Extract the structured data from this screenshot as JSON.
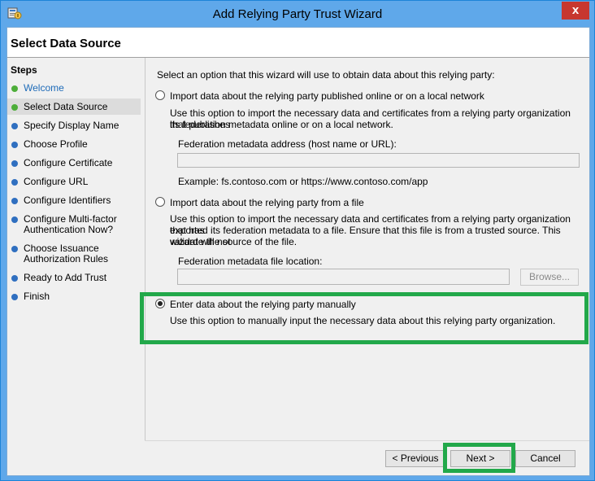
{
  "window": {
    "title": "Add Relying Party Trust Wizard",
    "close_glyph": "x",
    "app_icon": "relying-party-wizard-icon"
  },
  "header": {
    "title": "Select Data Source"
  },
  "steps": {
    "title": "Steps",
    "items": [
      {
        "label": "Welcome",
        "status": "completed"
      },
      {
        "label": "Select Data Source",
        "status": "current"
      },
      {
        "label": "Specify Display Name",
        "status": "pending"
      },
      {
        "label": "Choose Profile",
        "status": "pending"
      },
      {
        "label": "Configure Certificate",
        "status": "pending"
      },
      {
        "label": "Configure URL",
        "status": "pending"
      },
      {
        "label": "Configure Identifiers",
        "status": "pending"
      },
      {
        "label_line1": "Configure Multi-factor",
        "label_line2": "Authentication Now?",
        "status": "pending"
      },
      {
        "label_line1": "Choose Issuance",
        "label_line2": "Authorization Rules",
        "status": "pending"
      },
      {
        "label": "Ready to Add Trust",
        "status": "pending"
      },
      {
        "label": "Finish",
        "status": "pending"
      }
    ]
  },
  "content": {
    "intro": "Select an option that this wizard will use to obtain data about this relying party:",
    "option_online": {
      "label": "Import data about the relying party published online or on a local network",
      "desc_line1": "Use this option to import the necessary data and certificates from a relying party organization that publishes",
      "desc_line2": "its federation metadata online or on a local network.",
      "field_label": "Federation metadata address (host name or URL):",
      "field_value": "",
      "example": "Example: fs.contoso.com or https://www.contoso.com/app",
      "selected": false
    },
    "option_file": {
      "label": "Import data about the relying party from a file",
      "desc_line1": "Use this option to import the necessary data and certificates from a relying party organization that has",
      "desc_line2": "exported its federation metadata to a file. Ensure that this file is from a trusted source.  This wizard will not",
      "desc_line3": "validate the source of the file.",
      "field_label": "Federation metadata file location:",
      "field_value": "",
      "browse_label": "Browse...",
      "selected": false
    },
    "option_manual": {
      "label": "Enter data about the relying party manually",
      "desc": "Use this option to manually input the necessary data about this relying party organization.",
      "selected": true
    }
  },
  "footer": {
    "previous_label": "< Previous",
    "next_label": "Next >",
    "cancel_label": "Cancel"
  },
  "colors": {
    "titlebar": "#5fa8ea",
    "highlight": "#22a84a",
    "completed_dot": "#4dae3a",
    "pending_dot": "#2f6fc0",
    "close": "#c7372f"
  }
}
